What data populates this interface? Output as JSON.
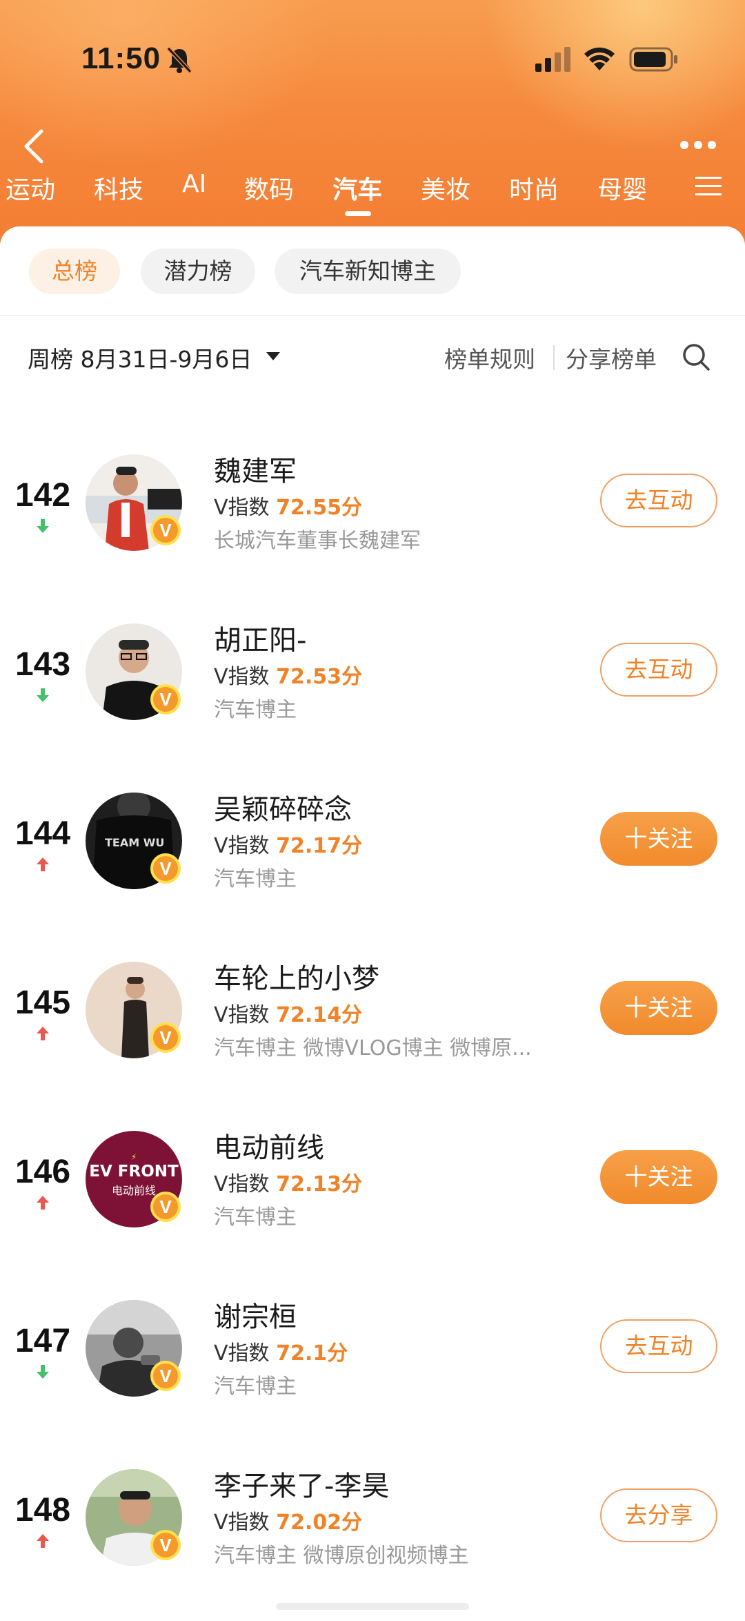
{
  "status_bar": {
    "time": "11:50"
  },
  "nav": {
    "tabs": [
      "运动",
      "科技",
      "AI",
      "数码",
      "汽车",
      "美妆",
      "时尚",
      "母婴"
    ],
    "active_tab": "汽车"
  },
  "chips": [
    "总榜",
    "潜力榜",
    "汽车新知博主"
  ],
  "filter": {
    "week_label": "周榜 8月31日-9月6日",
    "rules": "榜单规则",
    "share": "分享榜单"
  },
  "score_prefix": "V指数",
  "colors": {
    "accent": "#f08227",
    "up": "#e8584f",
    "down": "#45c06b"
  },
  "ranking": [
    {
      "rank": "142",
      "trend": "down",
      "name": "魏建军",
      "score": "72.55分",
      "desc": "长城汽车董事长魏建军",
      "action": "去互动",
      "action_style": "outline",
      "avatar_icon": "person-red-suit-avatar"
    },
    {
      "rank": "143",
      "trend": "down",
      "name": "胡正阳-",
      "score": "72.53分",
      "desc": "汽车博主",
      "action": "去互动",
      "action_style": "outline",
      "avatar_icon": "person-glasses-avatar"
    },
    {
      "rank": "144",
      "trend": "up",
      "name": "吴颖碎碎念",
      "score": "72.17分",
      "desc": "汽车博主",
      "action": "十关注",
      "action_style": "filled",
      "avatar_icon": "team-wu-shirt-avatar"
    },
    {
      "rank": "145",
      "trend": "up",
      "name": "车轮上的小梦",
      "score": "72.14分",
      "desc": "汽车博主 微博VLOG博主 微博原...",
      "action": "十关注",
      "action_style": "filled",
      "avatar_icon": "person-suit-avatar"
    },
    {
      "rank": "146",
      "trend": "up",
      "name": "电动前线",
      "score": "72.13分",
      "desc": "汽车博主",
      "action": "十关注",
      "action_style": "filled",
      "avatar_icon": "ev-front-logo-avatar",
      "logo_text": "EV FRONT",
      "logo_sub": "电动前线"
    },
    {
      "rank": "147",
      "trend": "down",
      "name": "谢宗桓",
      "score": "72.1分",
      "desc": "汽车博主",
      "action": "去互动",
      "action_style": "outline",
      "avatar_icon": "person-bw-avatar"
    },
    {
      "rank": "148",
      "trend": "up",
      "name": "李子来了-李昊",
      "score": "72.02分",
      "desc": "汽车博主 微博原创视频博主",
      "action": "去分享",
      "action_style": "outline",
      "avatar_icon": "person-outdoor-avatar"
    }
  ]
}
